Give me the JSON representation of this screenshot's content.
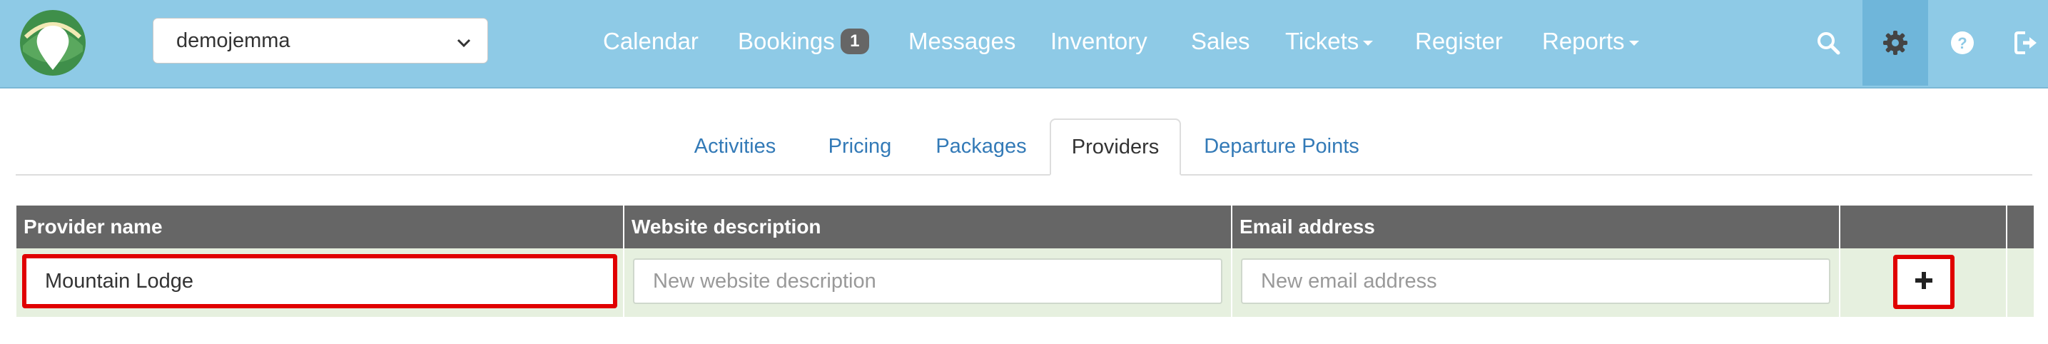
{
  "org_select": {
    "value": "demojemma"
  },
  "nav": {
    "calendar": "Calendar",
    "bookings": "Bookings",
    "bookings_badge": "1",
    "messages": "Messages",
    "inventory": "Inventory",
    "sales": "Sales",
    "tickets": "Tickets",
    "register": "Register",
    "reports": "Reports"
  },
  "icons": [
    "logo-icon",
    "search-icon",
    "gear-icon",
    "help-icon",
    "logout-icon",
    "plus-icon",
    "chevron-down-icon"
  ],
  "colors": {
    "navbar": "#8ecae6",
    "header": "#666666",
    "row": "#e6f0df",
    "highlight": "#e00000",
    "link": "#337ab7"
  },
  "tabs": {
    "activities": "Activities",
    "pricing": "Pricing",
    "packages": "Packages",
    "providers": "Providers",
    "departure_points": "Departure Points",
    "active": "Providers"
  },
  "table": {
    "columns": [
      "Provider name",
      "Website description",
      "Email address",
      ""
    ],
    "new_row": {
      "provider_name": "Mountain Lodge",
      "website_placeholder": "New website description",
      "email_placeholder": "New email address"
    }
  }
}
